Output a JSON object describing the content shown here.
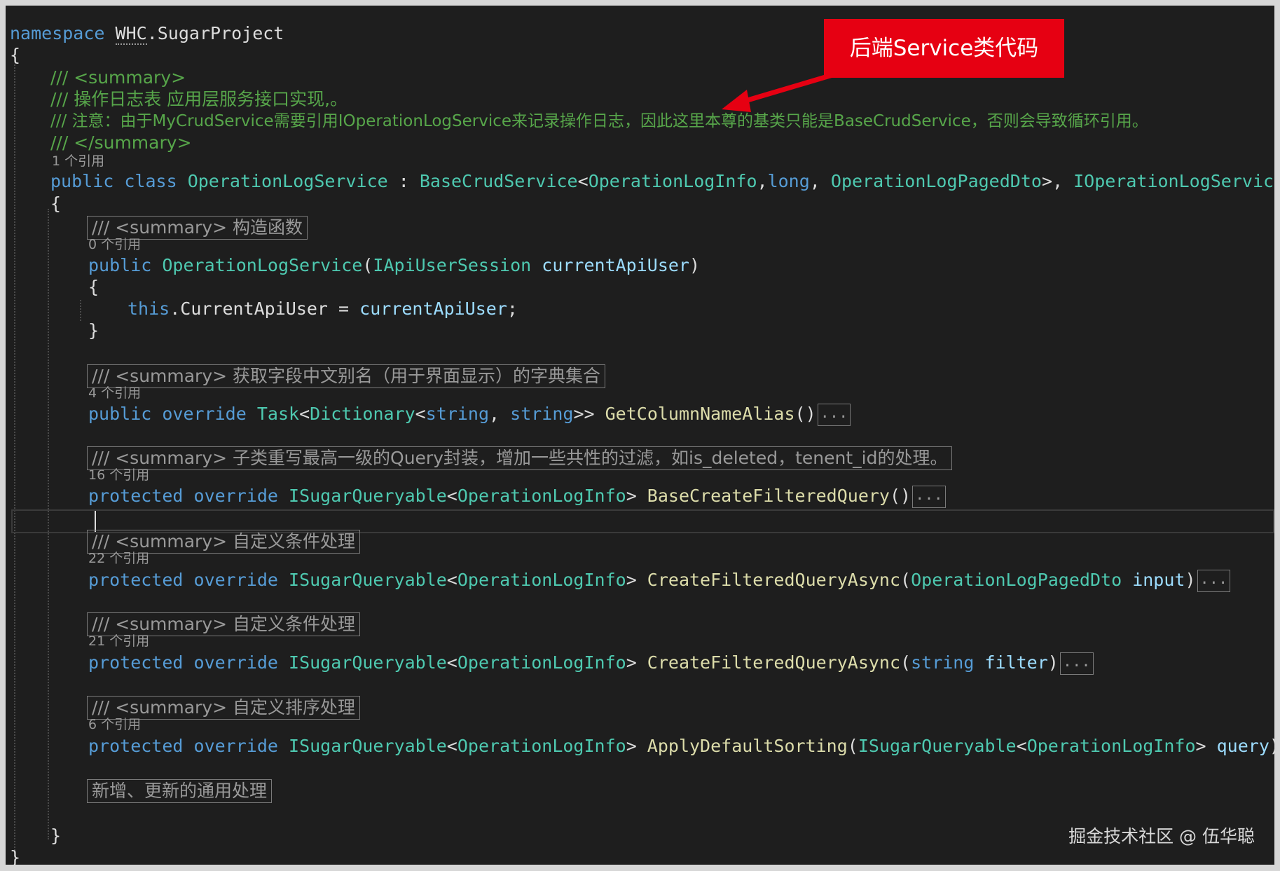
{
  "callout": {
    "text": "后端Service类代码",
    "color": "#e60012"
  },
  "watermark": "掘金技术社区 @ 伍华聪",
  "code": {
    "namespace_kw": "namespace",
    "namespace_part1": "WHC",
    "namespace_part2": ".SugarProject",
    "open_brace": "{",
    "close_brace": "}",
    "summary_open": "/// <summary>",
    "summary_line1": "/// 操作日志表 应用层服务接口实现,。",
    "summary_line2": "/// 注意：由于MyCrudService需要引用IOperationLogService来记录操作日志，因此这里本尊的基类只能是BaseCrudService，否则会导致循环引用。",
    "summary_close": "/// </summary>",
    "class_refs": "1 个引用",
    "class_decl": {
      "kw_public": "public",
      "kw_class": "class",
      "class_name": "OperationLogService",
      "colon": " : ",
      "base_type": "BaseCrudService",
      "lt": "<",
      "t1": "OperationLogInfo",
      "comma1": ",",
      "t2": "long",
      "comma2": ", ",
      "t3": "OperationLogPagedDto",
      "gt": ">, ",
      "iface": "IOperationLogService"
    },
    "members": [
      {
        "summary": "/// <summary> 构造函数",
        "refs": "0 个引用",
        "kw": "public",
        "ctor_name": "OperationLogService",
        "paren_open": "(",
        "param_type": "IApiUserSession",
        "param_name": "currentApiUser",
        "paren_close": ")",
        "body_this": "this",
        "body_member": ".CurrentApiUser = ",
        "body_value": "currentApiUser",
        "body_semicolon": ";"
      },
      {
        "summary": "/// <summary> 获取字段中文别名（用于界面显示）的字典集合",
        "refs": "4 个引用",
        "kw1": "public",
        "kw2": "override",
        "ret_type": "Task",
        "lt": "<",
        "dict": "Dictionary",
        "lt2": "<",
        "t1": "string",
        "comma": ", ",
        "t2": "string",
        "gt": ">> ",
        "name": "GetColumnNameAlias",
        "parens": "()",
        "dots": "..."
      },
      {
        "summary": "/// <summary> 子类重写最高一级的Query封装，增加一些共性的过滤，如is_deleted，tenent_id的处理。",
        "refs": "16 个引用",
        "kw1": "protected",
        "kw2": "override",
        "ret_type": "ISugarQueryable",
        "lt": "<",
        "t1": "OperationLogInfo",
        "gt": "> ",
        "name": "BaseCreateFilteredQuery",
        "parens": "()",
        "dots": "..."
      },
      {
        "summary": "/// <summary> 自定义条件处理",
        "refs": "22 个引用",
        "kw1": "protected",
        "kw2": "override",
        "ret_type": "ISugarQueryable",
        "lt": "<",
        "t1": "OperationLogInfo",
        "gt": "> ",
        "name": "CreateFilteredQueryAsync",
        "paren_open": "(",
        "param_type": "OperationLogPagedDto",
        "param_name": "input",
        "paren_close": ")",
        "dots": "..."
      },
      {
        "summary": "/// <summary> 自定义条件处理",
        "refs": "21 个引用",
        "kw1": "protected",
        "kw2": "override",
        "ret_type": "ISugarQueryable",
        "lt": "<",
        "t1": "OperationLogInfo",
        "gt": "> ",
        "name": "CreateFilteredQueryAsync",
        "paren_open": "(",
        "param_type": "string",
        "param_name": "filter",
        "paren_close": ")",
        "dots": "..."
      },
      {
        "summary": "/// <summary> 自定义排序处理",
        "refs": "6 个引用",
        "kw1": "protected",
        "kw2": "override",
        "ret_type": "ISugarQueryable",
        "lt": "<",
        "t1": "OperationLogInfo",
        "gt": "> ",
        "name": "ApplyDefaultSorting",
        "paren_open": "(",
        "param_type": "ISugarQueryable",
        "param_lt": "<",
        "param_t1": "OperationLogInfo",
        "param_gt": "> ",
        "param_name": "query",
        "paren_close": ")",
        "dots": "..."
      }
    ],
    "region": "新增、更新的通用处理"
  }
}
